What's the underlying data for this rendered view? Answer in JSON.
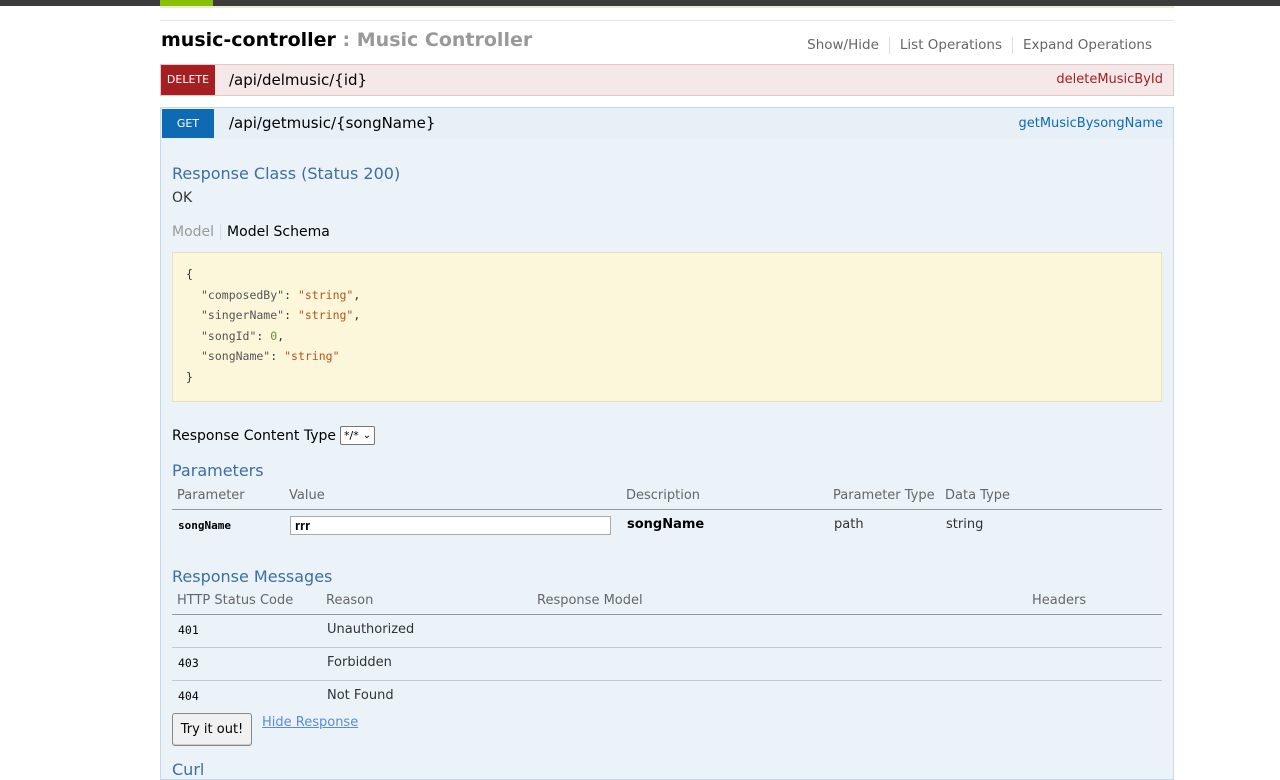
{
  "controller": {
    "name": "music-controller",
    "separator": " : ",
    "description": "Music Controller",
    "ops": [
      "Show/Hide",
      "List Operations",
      "Expand Operations"
    ]
  },
  "delete_op": {
    "method": "DELETE",
    "path": "/api/delmusic/{id}",
    "nickname": "deleteMusicById"
  },
  "get_op": {
    "method": "GET",
    "path": "/api/getmusic/{songName}",
    "nickname": "getMusicBysongName",
    "response_class_title": "Response Class (Status 200)",
    "response_class_value": "OK",
    "model_tab": "Model",
    "model_schema_tab": "Model Schema",
    "schema": {
      "open": "{",
      "composedBy_key": "\"composedBy\"",
      "composedBy_val": "\"string\"",
      "singerName_key": "\"singerName\"",
      "singerName_val": "\"string\"",
      "songId_key": "\"songId\"",
      "songId_val": "0",
      "songName_key": "\"songName\"",
      "songName_val": "\"string\"",
      "close": "}"
    },
    "content_type_label": "Response Content Type",
    "content_type_value": "*/*",
    "parameters_title": "Parameters",
    "param_headers": [
      "Parameter",
      "Value",
      "Description",
      "Parameter Type",
      "Data Type"
    ],
    "params": [
      {
        "name": "songName",
        "value": "rrr",
        "description": "songName",
        "param_type": "path",
        "data_type": "string"
      }
    ],
    "response_messages_title": "Response Messages",
    "rm_headers": [
      "HTTP Status Code",
      "Reason",
      "Response Model",
      "Headers"
    ],
    "response_messages": [
      {
        "code": "401",
        "reason": "Unauthorized"
      },
      {
        "code": "403",
        "reason": "Forbidden"
      },
      {
        "code": "404",
        "reason": "Not Found"
      }
    ],
    "try_button": "Try it out!",
    "hide_response": "Hide Response",
    "curl_title": "Curl"
  }
}
